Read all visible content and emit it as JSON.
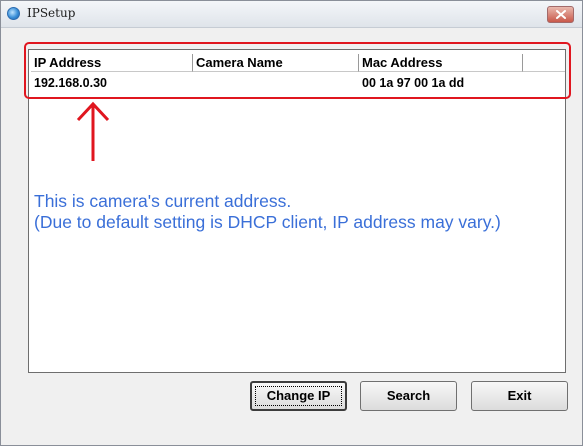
{
  "window": {
    "title": "IPSetup",
    "app_icon": "globe-icon",
    "close_icon": "close-icon"
  },
  "table": {
    "columns": [
      "IP Address",
      "Camera Name",
      "Mac Address"
    ],
    "rows": [
      {
        "ip": "192.168.0.30",
        "camera_name": "",
        "mac": "00 1a 97 00 1a dd"
      }
    ]
  },
  "annotation": {
    "line1": "This is camera's current address.",
    "line2": "(Due to default setting is DHCP client, IP address may vary.)",
    "highlight_color": "#e0161f",
    "text_color": "#3a6fd8"
  },
  "buttons": {
    "change_ip": "Change IP",
    "search": "Search",
    "exit": "Exit"
  }
}
